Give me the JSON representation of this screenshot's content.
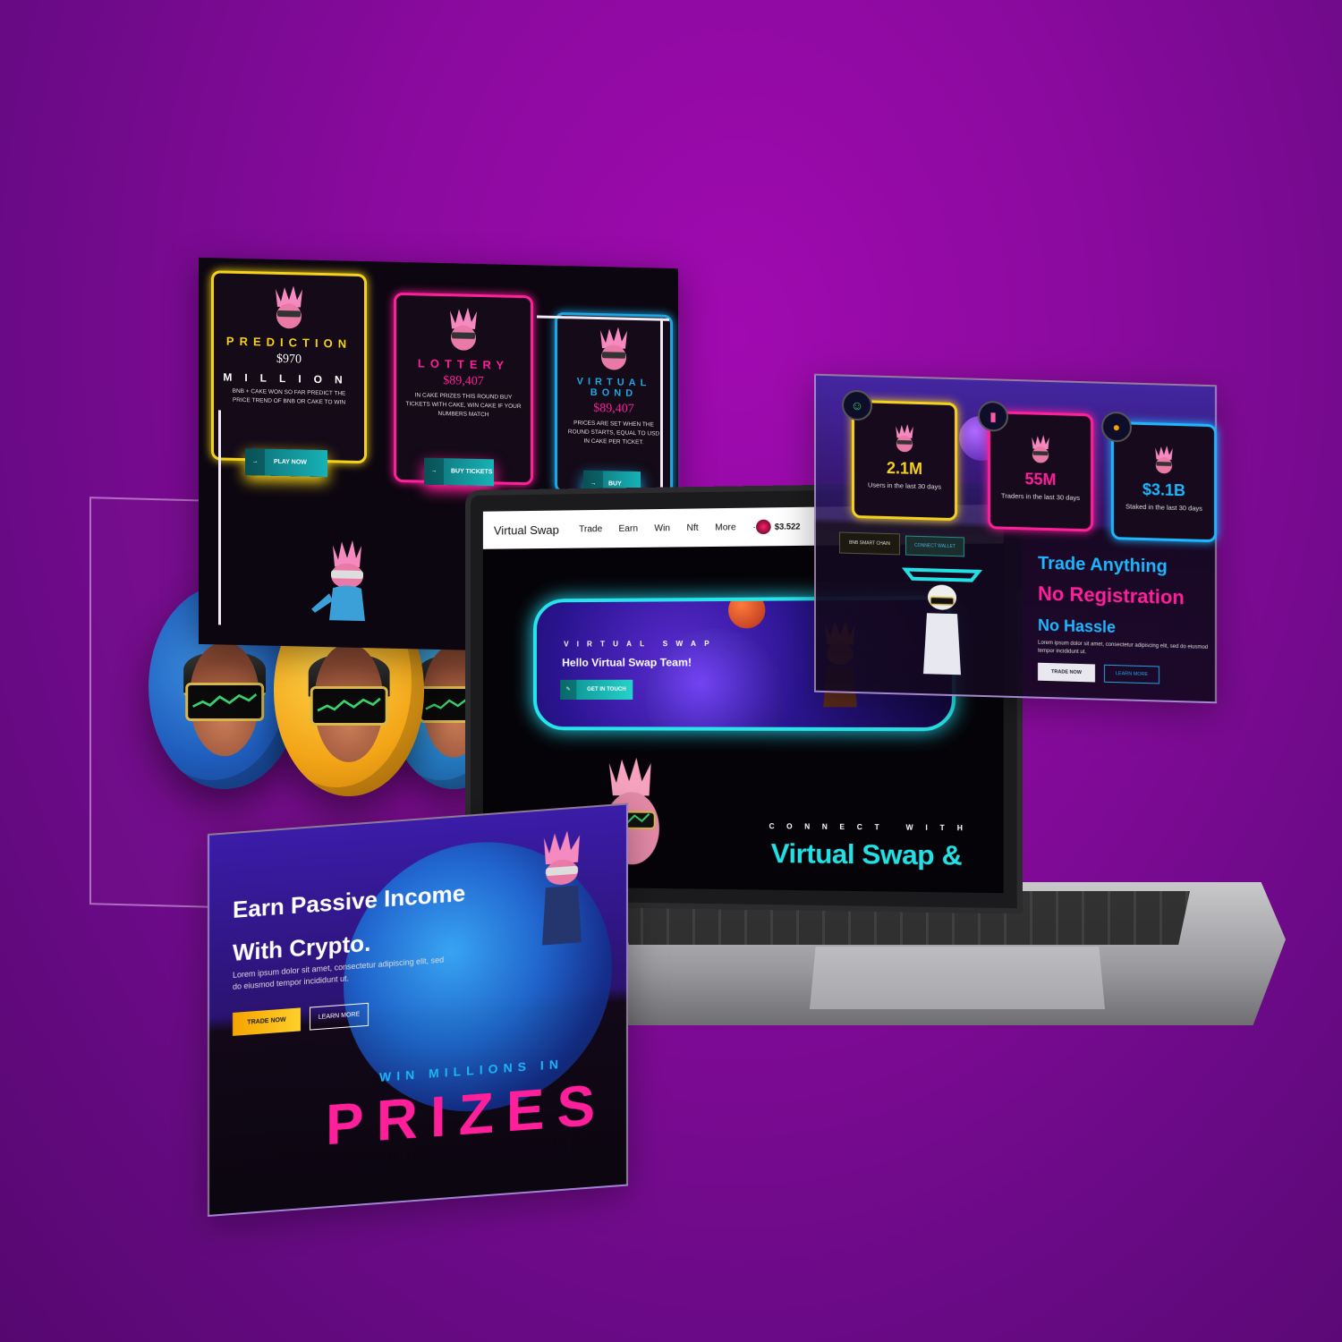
{
  "colors": {
    "background": "#8a0a9e",
    "neon_cyan": "#22e0e4",
    "neon_pink": "#ff1f9b",
    "neon_blue": "#1eb6ff",
    "gold": "#f5d21a"
  },
  "game_panel": {
    "cards": [
      {
        "title": "PREDICTION",
        "amount": "$970",
        "subtitle": "MILLION",
        "text": "BNB + CAKE WON SO FAR PREDICT THE PRICE TREND OF BNB OR CAKE TO WIN",
        "button": "PLAY NOW",
        "button_icon": "arrow-icon",
        "accent": "#f5d21a"
      },
      {
        "title": "LOTTERY",
        "amount": "$89,407",
        "subtitle": "",
        "text": "IN CAKE PRIZES THIS ROUND BUY TICKETS WITH CAKE, WIN CAKE IF YOUR NUMBERS MATCH",
        "button": "BUY TICKETS",
        "button_icon": "arrow-icon",
        "accent": "#ff1f9b"
      },
      {
        "title": "VIRTUAL BOND",
        "amount": "$89,407",
        "subtitle": "",
        "text": "PRICES ARE SET WHEN THE ROUND STARTS, EQUAL TO USD IN CAKE PER TICKET.",
        "button": "BUY TICKETS",
        "button_icon": "arrow-icon",
        "accent": "#1ea6e0"
      }
    ]
  },
  "laptop": {
    "navbar": {
      "brand": "Virtual Swap",
      "items": [
        "Trade",
        "Earn",
        "Win",
        "Nft",
        "More",
        "···"
      ],
      "price": "$3.522"
    },
    "hero": {
      "label": "VIRTUAL SWAP",
      "title": "Hello Virtual Swap Team!",
      "button": "GET IN TOUCH"
    },
    "connect": {
      "label": "CONNECT WITH",
      "title": "Virtual Swap &"
    }
  },
  "stats_panel": {
    "chain_label": "BNB SMART CHAIN",
    "connect_wallet": "CONNECT WALLET",
    "stats": [
      {
        "value": "2.1M",
        "caption": "Users in the last 30 days",
        "color": "#f5d21a",
        "icon": "users-icon"
      },
      {
        "value": "55M",
        "caption": "Traders in the last 30 days",
        "color": "#ff1f9b",
        "icon": "chart-icon"
      },
      {
        "value": "$3.1B",
        "caption": "Staked in the last 30 days",
        "color": "#1eb6ff",
        "icon": "coin-icon"
      }
    ],
    "headline1": "Trade Anything",
    "headline2": "No Registration",
    "headline3": "No Hassle",
    "text": "Lorem ipsum dolor sit amet, consectetur adipiscing elit, sed do eiusmod tempor incididunt ut.",
    "button_primary": "TRADE NOW",
    "button_secondary": "LEARN MORE"
  },
  "earn_panel": {
    "title_line1": "Earn Passive Income",
    "title_line2": "With Crypto.",
    "text": "Lorem ipsum dolor sit amet, consectetur adipiscing elit, sed do eiusmod tempor incididunt ut.",
    "button_primary": "TRADE NOW",
    "button_secondary": "LEARN MORE",
    "win_label": "WIN MILLIONS IN",
    "prizes": "PRIZES"
  }
}
